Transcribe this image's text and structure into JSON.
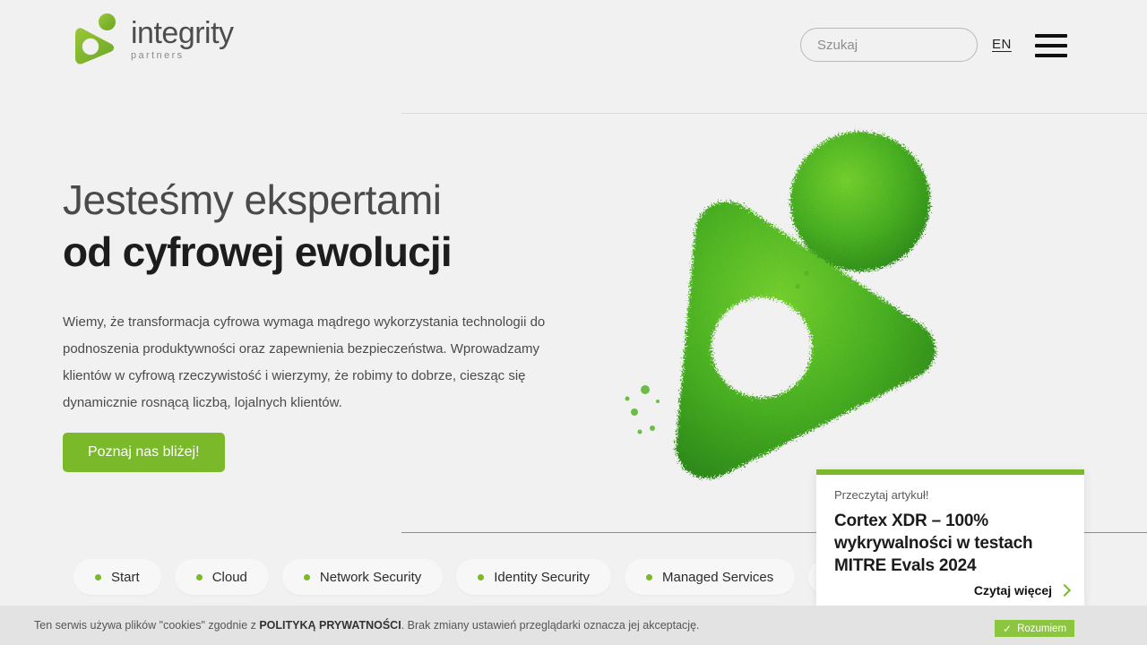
{
  "brand": {
    "name": "integrity",
    "tagline": "partners",
    "accent_color": "#7ab929",
    "logo_icon": "integrity-play-mark-icon"
  },
  "header": {
    "search": {
      "placeholder": "Szukaj",
      "value": "",
      "icon": "search-input"
    },
    "language_label": "EN",
    "menu_icon": "hamburger-menu-icon"
  },
  "hero": {
    "heading_light": "Jesteśmy ekspertami",
    "heading_bold": "od cyfrowej ewolucji",
    "paragraph": "Wiemy, że transformacja cyfrowa wymaga mądrego wykorzystania technologii do podnoszenia produktywności oraz zapewnienia bezpieczeństwa. Wprowadzamy klientów w cyfrową rzeczywistość i wierzymy, że robimy to dobrze, ciesząc się dynamicznie rosnącą liczbą, lojalnych klientów.",
    "cta_label": "Poznaj nas bliżej!",
    "art_alt": "moss-textured-integrity-logo-image"
  },
  "categories": [
    {
      "label": "Start"
    },
    {
      "label": "Cloud"
    },
    {
      "label": "Network Security"
    },
    {
      "label": "Identity Security"
    },
    {
      "label": "Managed Services"
    },
    {
      "label": ""
    }
  ],
  "article_card": {
    "kicker": "Przeczytaj artykuł!",
    "title": "Cortex XDR – 100% wykrywalności w testach MITRE Evals 2024",
    "more_label": "Czytaj więcej",
    "chevron_icon": "chevron-right-icon",
    "accent_color": "#7ab929"
  },
  "cookie_bar": {
    "text_before": "Ten serwis używa plików \"cookies\" zgodnie z ",
    "link_label": "POLITYKĄ PRYWATNOŚCI",
    "text_after": ". Brak zmiany ustawień przeglądarki oznacza jej akceptację.",
    "accept_label": "Rozumiem",
    "accept_icon": "check-icon"
  }
}
